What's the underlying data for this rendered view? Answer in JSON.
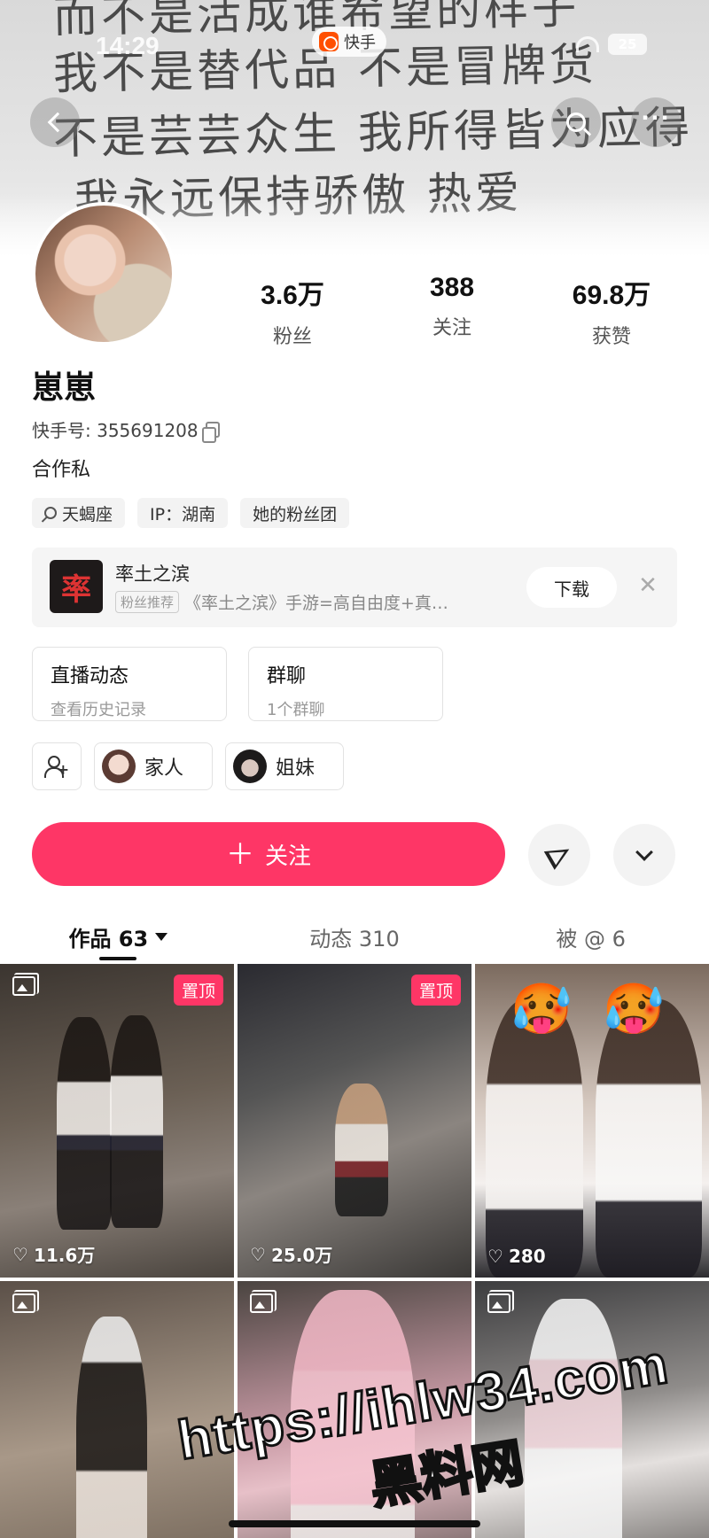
{
  "status_bar": {
    "time": "14:29",
    "app_name": "快手",
    "battery": "25"
  },
  "banner": {
    "lines": [
      "而不是活成谁希望的样子",
      "我不是替代品 不是冒牌货",
      "不是芸芸众生 我所得皆为应得",
      "我永远保持骄傲 热爱",
      "…"
    ]
  },
  "profile": {
    "name": "崽崽",
    "uid_label": "快手号: 355691208",
    "bio": "合作私",
    "stats": [
      {
        "value": "3.6万",
        "label": "粉丝"
      },
      {
        "value": "388",
        "label": "关注"
      },
      {
        "value": "69.8万",
        "label": "获赞"
      }
    ],
    "tags": [
      "天蝎座",
      "IP：湖南",
      "她的粉丝团"
    ]
  },
  "ad": {
    "logo_char": "率",
    "title": "率土之滨",
    "badge": "粉丝推荐",
    "description": "《率土之滨》手游=高自由度+真…",
    "download_label": "下载",
    "close_glyph": "✕"
  },
  "quick_cards": [
    {
      "title": "直播动态",
      "subtitle": "查看历史记录"
    },
    {
      "title": "群聊",
      "subtitle": "1个群聊"
    }
  ],
  "groups": [
    {
      "label": "家人"
    },
    {
      "label": "姐妹"
    }
  ],
  "actions": {
    "follow_label": "关注",
    "follow_glyph": "＋"
  },
  "tabs": [
    {
      "label": "作品 63",
      "active": true
    },
    {
      "label": "动态 310",
      "active": false
    },
    {
      "label": "被 @ 6",
      "active": false
    }
  ],
  "posts": [
    {
      "likes": "11.6万",
      "pinned_label": "置顶"
    },
    {
      "likes": "25.0万",
      "pinned_label": "置顶"
    },
    {
      "likes": "280",
      "emoji": [
        "🥵",
        "🥵"
      ]
    },
    {},
    {},
    {}
  ],
  "icons": {
    "heart": "♡"
  },
  "colors": {
    "accent": "#fe3666"
  },
  "watermark": {
    "url": "https://ihlw34.com",
    "name": "黑料网"
  }
}
